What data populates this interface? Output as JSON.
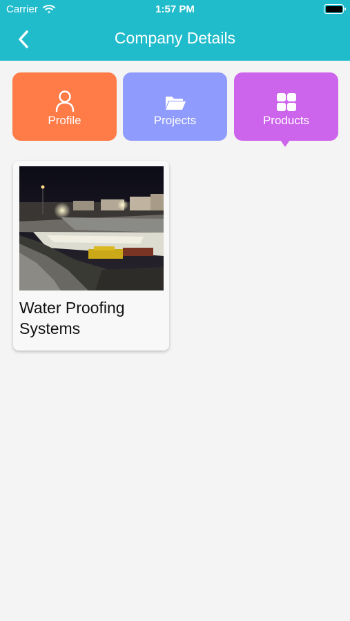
{
  "status_bar": {
    "carrier": "Carrier",
    "time": "1:57 PM",
    "wifi_icon": "wifi-icon",
    "battery_icon": "battery-icon"
  },
  "header": {
    "title": "Company Details",
    "back_icon": "chevron-left-icon",
    "background_color": "#21bccc"
  },
  "tabs": [
    {
      "label": "Profile",
      "icon": "user-icon",
      "color": "#ff7b47"
    },
    {
      "label": "Projects",
      "icon": "folder-icon",
      "color": "#8f9bfd"
    },
    {
      "label": "Products",
      "icon": "grid-icon",
      "color": "#cd64ec",
      "selected": true
    }
  ],
  "products": [
    {
      "title": "Water Proofing Systems",
      "image": "construction-site-night-photo"
    }
  ]
}
